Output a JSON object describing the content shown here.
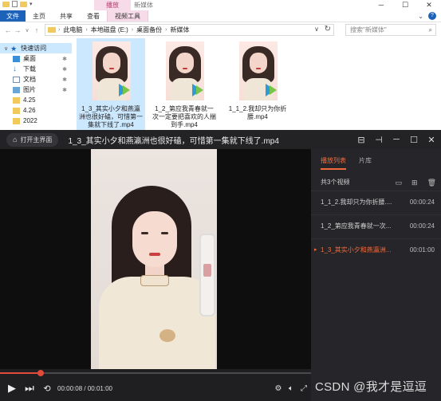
{
  "explorer": {
    "context_tab": "播放",
    "window_title": "新媒体",
    "ribbon_tabs": [
      "文件",
      "主页",
      "共享",
      "查看",
      "视频工具"
    ],
    "address": {
      "segments": [
        "此电脑",
        "本地磁盘 (E:)",
        "桌面备份",
        "新媒体"
      ]
    },
    "search_placeholder": "搜索\"新媒体\"",
    "nav": {
      "quick_access": "快速访问",
      "items": [
        {
          "label": "桌面",
          "pinned": true
        },
        {
          "label": "下载",
          "pinned": true
        },
        {
          "label": "文档",
          "pinned": true
        },
        {
          "label": "图片",
          "pinned": true
        },
        {
          "label": "4.25",
          "pinned": false
        },
        {
          "label": "4.26",
          "pinned": false
        },
        {
          "label": "2022",
          "pinned": false
        }
      ]
    },
    "files": [
      {
        "name": "1_3_其实小夕和燕瀛洲也很好磕，可惜第一集就下线了.mp4",
        "selected": true
      },
      {
        "name": "1_2_第应我青春就一次一定要把喜欢的人揣到手.mp4",
        "selected": false
      },
      {
        "name": "1_1_2.我却只为你折腰.mp4",
        "selected": false
      }
    ]
  },
  "player": {
    "home_button": "打开主界面",
    "title": "1_3_其实小夕和燕瀛洲也很好磕，可惜第一集就下线了.mp4",
    "time_current": "00:00:08",
    "time_total": "00:01:00",
    "progress_fraction": 0.13,
    "accent_color": "#f06a3b",
    "playlist": {
      "tabs": [
        "播放列表",
        "片库"
      ],
      "count_label": "共3个视频",
      "items": [
        {
          "name": "1_1_2.我却只为你折腰....",
          "duration": "00:00:24",
          "playing": false
        },
        {
          "name": "1_2_第应我青春就一次...",
          "duration": "00:00:24",
          "playing": false
        },
        {
          "name": "1_3_其实小夕和燕瀛洲...",
          "duration": "00:01:00",
          "playing": true
        }
      ]
    }
  },
  "watermark": "CSDN @我才是逗逗"
}
